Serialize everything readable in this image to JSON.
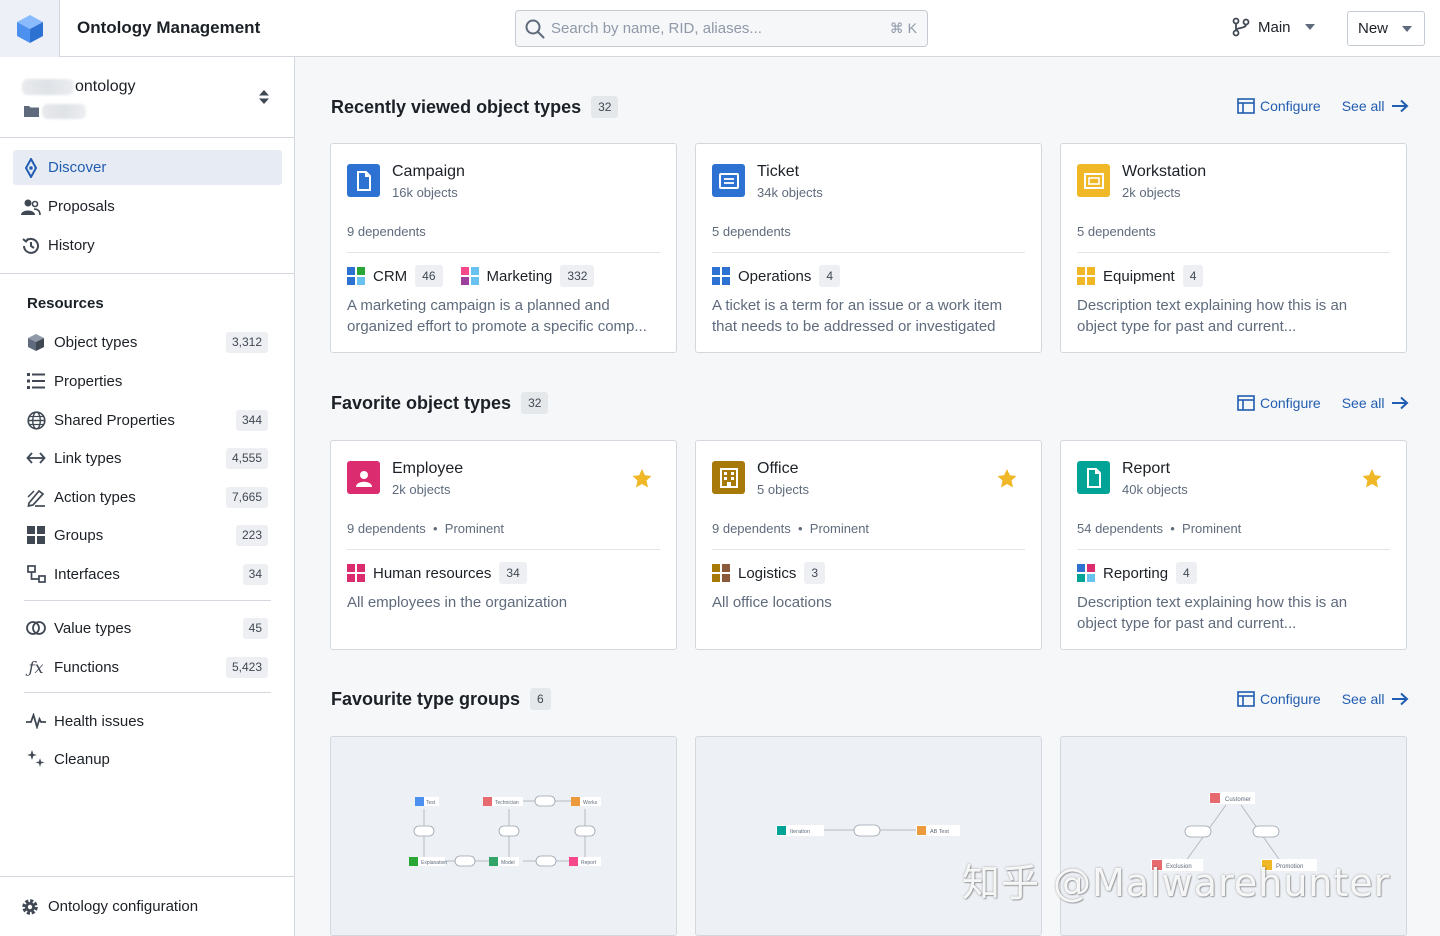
{
  "app": {
    "title": "Ontology Management"
  },
  "search": {
    "placeholder": "Search by name, RID, aliases...",
    "shortcut": "⌘ K"
  },
  "branch": {
    "label": "Main"
  },
  "new_button": {
    "label": "New"
  },
  "sidebar": {
    "ontology_name": "ontology",
    "nav": [
      {
        "label": "Discover",
        "icon": "discover-icon",
        "active": true
      },
      {
        "label": "Proposals",
        "icon": "proposals-icon"
      },
      {
        "label": "History",
        "icon": "history-icon"
      }
    ],
    "resources_title": "Resources",
    "resources": [
      {
        "label": "Object types",
        "count": "3,312",
        "icon": "cube-icon"
      },
      {
        "label": "Properties",
        "count": "",
        "icon": "list-icon"
      },
      {
        "label": "Shared Properties",
        "count": "344",
        "icon": "globe-icon"
      },
      {
        "label": "Link types",
        "count": "4,555",
        "icon": "arrows-icon"
      },
      {
        "label": "Action types",
        "count": "7,665",
        "icon": "edit-icon"
      },
      {
        "label": "Groups",
        "count": "223",
        "icon": "grid-icon"
      },
      {
        "label": "Interfaces",
        "count": "34",
        "icon": "interface-icon"
      },
      {
        "label": "Value types",
        "count": "45",
        "icon": "value-icon"
      },
      {
        "label": "Functions",
        "count": "5,423",
        "icon": "function-icon"
      },
      {
        "label": "Health issues",
        "count": "",
        "icon": "pulse-icon"
      },
      {
        "label": "Cleanup",
        "count": "",
        "icon": "sparkle-icon"
      }
    ],
    "configuration_label": "Ontology configuration"
  },
  "sections": {
    "configure_label": "Configure",
    "see_all_label": "See all",
    "recent": {
      "title": "Recently viewed object types",
      "count": "32",
      "cards": [
        {
          "name": "Campaign",
          "sub": "16k objects",
          "deps": "9 dependents",
          "icon_color": "#2d72d2",
          "groups": [
            {
              "label": "CRM",
              "count": "46",
              "colors": [
                "#2d72d2",
                "#29a634",
                "#2d72d2",
                "#68c1ee"
              ]
            },
            {
              "label": "Marketing",
              "count": "332",
              "colors": [
                "#f5498b",
                "#68c1ee",
                "#9d3f9d",
                "#68c1ee"
              ]
            }
          ],
          "desc": [
            "A marketing campaign is a planned and",
            "organized effort to promote a specific comp..."
          ]
        },
        {
          "name": "Ticket",
          "sub": "34k objects",
          "deps": "5 dependents",
          "icon_color": "#2d72d2",
          "groups": [
            {
              "label": "Operations",
              "count": "4",
              "colors": [
                "#2d72d2",
                "#2d72d2",
                "#2d72d2",
                "#2d72d2"
              ]
            }
          ],
          "desc": [
            "A ticket is a term for an issue or a work item",
            "that needs to be addressed or investigated"
          ]
        },
        {
          "name": "Workstation",
          "sub": "2k objects",
          "deps": "5 dependents",
          "icon_color": "#f0b726",
          "groups": [
            {
              "label": "Equipment",
              "count": "4",
              "colors": [
                "#f0b726",
                "#f0b726",
                "#f0b726",
                "#f0b726"
              ]
            }
          ],
          "desc": [
            "Description text explaining how this is an",
            "object type for past and current..."
          ]
        }
      ]
    },
    "favorite": {
      "title": "Favorite object types",
      "count": "32",
      "cards": [
        {
          "name": "Employee",
          "sub": "2k objects",
          "deps": "9 dependents",
          "prominent": "Prominent",
          "icon_color": "#db2c6f",
          "groups": [
            {
              "label": "Human resources",
              "count": "34",
              "colors": [
                "#db2c6f",
                "#db2c6f",
                "#db2c6f",
                "#db2c6f"
              ]
            }
          ],
          "desc": [
            "All employees in the organization"
          ]
        },
        {
          "name": "Office",
          "sub": "5 objects",
          "deps": "9 dependents",
          "prominent": "Prominent",
          "icon_color": "#a67908",
          "groups": [
            {
              "label": "Logistics",
              "count": "3",
              "colors": [
                "#a67908",
                "#8a5a3c",
                "#a67908",
                "#8a5a3c"
              ]
            }
          ],
          "desc": [
            "All office locations"
          ]
        },
        {
          "name": "Report",
          "sub": "40k objects",
          "deps": "54 dependents",
          "prominent": "Prominent",
          "icon_color": "#00a396",
          "groups": [
            {
              "label": "Reporting",
              "count": "4",
              "colors": [
                "#2d72d2",
                "#db2c6f",
                "#00a396",
                "#68c1ee"
              ]
            }
          ],
          "desc": [
            "Description text explaining how this is an",
            "object type for past and current..."
          ]
        }
      ]
    },
    "groups": {
      "title": "Favourite type groups",
      "count": "6",
      "thumb1": {
        "test": "Test",
        "technician": "Technician",
        "works": "Works",
        "explanation": "Explanation",
        "model": "Model",
        "report": "Report"
      },
      "thumb2": {
        "iteration": "Iteration",
        "abtest": "AB Test"
      },
      "thumb3": {
        "customer": "Customer",
        "exclusion": "Exclusion",
        "promotion": "Promotion"
      }
    }
  },
  "watermark": "知乎 @Malwarehunter",
  "colors": {
    "accent": "#215db0",
    "star": "#f0b726",
    "active_bg": "#e7ecf4"
  }
}
